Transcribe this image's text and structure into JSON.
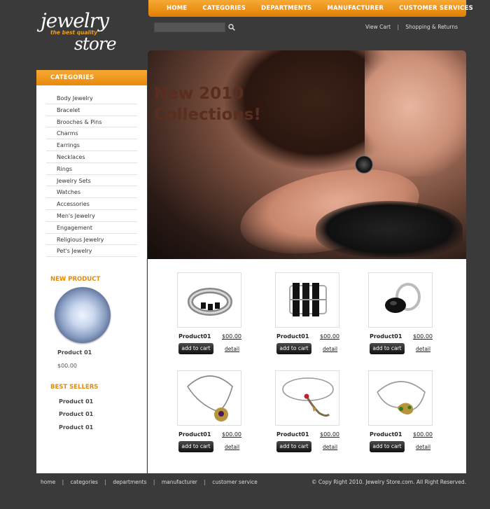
{
  "logo": {
    "line1": "jewelry",
    "tagline": "the best quality",
    "line2": "store"
  },
  "nav": {
    "items": [
      "HOME",
      "CATEGORIES",
      "DEPARTMENTS",
      "MANUFACTURER",
      "CUSTOMER SERVICES"
    ]
  },
  "search": {
    "placeholder": ""
  },
  "toplinks": {
    "view_cart": "View Cart",
    "separator": "|",
    "shipping": "Shopping & Returns"
  },
  "categories": {
    "title": "CATEGORIES",
    "items": [
      "Body Jewelry",
      "Bracelet",
      "Brooches & Pins",
      "Charms",
      "Earrings",
      "Necklaces",
      "Rings",
      "Jewelry Sets",
      "Watches",
      "Accessories",
      "Men's Jewelry",
      "Engagement",
      "Religious Jewelry",
      "Pet's Jewelry"
    ]
  },
  "banner": {
    "line1": "New 2010",
    "line2": "Collections!"
  },
  "new_product": {
    "title": "NEW PRODUCT",
    "name": "Product 01",
    "price": "$00.00"
  },
  "best_sellers": {
    "title": "BEST SELLERS",
    "items": [
      "Product 01",
      "Product 01",
      "Product 01"
    ]
  },
  "products": [
    {
      "name": "Product01",
      "price": "$00.00",
      "cart_label": "add to cart",
      "detail_label": "detail",
      "icon": "ring-icon"
    },
    {
      "name": "Product01",
      "price": "$00.00",
      "cart_label": "add to cart",
      "detail_label": "detail",
      "icon": "ring-icon"
    },
    {
      "name": "Product01",
      "price": "$00.00",
      "cart_label": "add to cart",
      "detail_label": "detail",
      "icon": "ring-icon"
    },
    {
      "name": "Product01",
      "price": "$00.00",
      "cart_label": "add to cart",
      "detail_label": "detail",
      "icon": "necklace-icon"
    },
    {
      "name": "Product01",
      "price": "$00.00",
      "cart_label": "add to cart",
      "detail_label": "detail",
      "icon": "necklace-icon"
    },
    {
      "name": "Product01",
      "price": "$00.00",
      "cart_label": "add to cart",
      "detail_label": "detail",
      "icon": "necklace-icon"
    }
  ],
  "footer": {
    "links": [
      "home",
      "categories",
      "departments",
      "manufacturer",
      "customer service"
    ],
    "separator": "|",
    "copyright": "© Copy Right 2010. Jewelry Store.com. All Right Reserved."
  },
  "colors": {
    "accent": "#f39c12",
    "background": "#3a3a3a",
    "banner_text": "#5a2e1e"
  }
}
